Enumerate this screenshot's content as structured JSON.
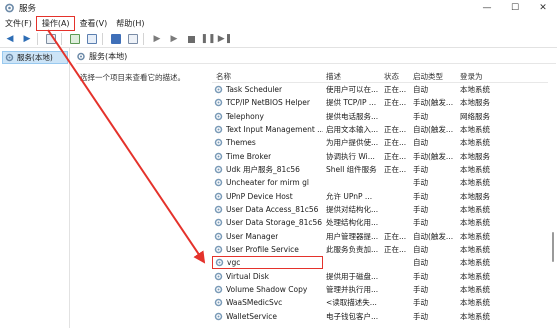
{
  "window": {
    "title": "服务",
    "minimize": "—",
    "maximize": "☐",
    "close": "✕"
  },
  "menu": [
    "文件(F)",
    "操作(A)",
    "查看(V)",
    "帮助(H)"
  ],
  "tree": {
    "item": "服务(本地)"
  },
  "pane": {
    "header": "服务(本地)",
    "description": "选择一个项目来查看它的描述。"
  },
  "columns": [
    "名称",
    "描述",
    "状态",
    "启动类型",
    "登录为"
  ],
  "rows": [
    {
      "name": "Task Scheduler",
      "desc": "使用户可以在...",
      "status": "正在...",
      "startup": "自动",
      "logon": "本地系统"
    },
    {
      "name": "TCP/IP NetBIOS Helper",
      "desc": "提供 TCP/IP ...",
      "status": "正在...",
      "startup": "手动(触发...",
      "logon": "本地服务"
    },
    {
      "name": "Telephony",
      "desc": "提供电话服务...",
      "status": "",
      "startup": "手动",
      "logon": "网络服务"
    },
    {
      "name": "Text Input Management ...",
      "desc": "启用文本输入...",
      "status": "正在...",
      "startup": "自动(触发...",
      "logon": "本地系统"
    },
    {
      "name": "Themes",
      "desc": "为用户提供使...",
      "status": "正在...",
      "startup": "自动",
      "logon": "本地系统"
    },
    {
      "name": "Time Broker",
      "desc": "协调执行 Wi...",
      "status": "正在...",
      "startup": "手动(触发...",
      "logon": "本地服务"
    },
    {
      "name": "Udk 用户服务_81c56",
      "desc": "Shell 组件服务",
      "status": "正在...",
      "startup": "手动",
      "logon": "本地系统"
    },
    {
      "name": "Uncheater for mirm gl",
      "desc": "",
      "status": "",
      "startup": "手动",
      "logon": "本地系统"
    },
    {
      "name": "UPnP Device Host",
      "desc": "允许 UPnP ...",
      "status": "",
      "startup": "手动",
      "logon": "本地服务"
    },
    {
      "name": "User Data Access_81c56",
      "desc": "提供对结构化...",
      "status": "",
      "startup": "手动",
      "logon": "本地系统"
    },
    {
      "name": "User Data Storage_81c56",
      "desc": "处理结构化用...",
      "status": "",
      "startup": "手动",
      "logon": "本地系统"
    },
    {
      "name": "User Manager",
      "desc": "用户管理器提...",
      "status": "正在...",
      "startup": "自动(触发...",
      "logon": "本地系统"
    },
    {
      "name": "User Profile Service",
      "desc": "此服务负责加...",
      "status": "正在...",
      "startup": "自动",
      "logon": "本地系统"
    },
    {
      "name": "vgc",
      "desc": "",
      "status": "",
      "startup": "自动",
      "logon": "本地系统"
    },
    {
      "name": "Virtual Disk",
      "desc": "提供用于磁盘...",
      "status": "",
      "startup": "手动",
      "logon": "本地系统"
    },
    {
      "name": "Volume Shadow Copy",
      "desc": "管理并执行用...",
      "status": "",
      "startup": "手动",
      "logon": "本地系统"
    },
    {
      "name": "WaaSMedicSvc",
      "desc": "<读取描述失...",
      "status": "",
      "startup": "手动",
      "logon": "本地系统"
    },
    {
      "name": "WalletService",
      "desc": "电子钱包客户...",
      "status": "",
      "startup": "手动",
      "logon": "本地系统"
    }
  ],
  "colors": {
    "annotation": "#e4322b",
    "selection": "#cce4f7",
    "gear": "#7a9bb8"
  }
}
